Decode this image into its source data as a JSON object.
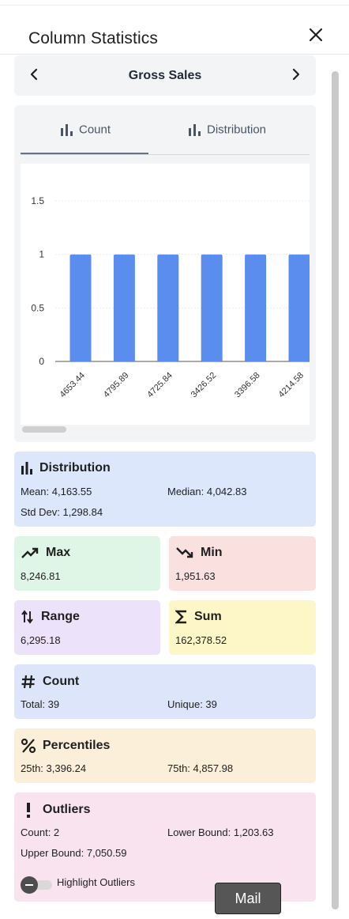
{
  "header": {
    "title": "Column Statistics",
    "close_icon": "close-icon"
  },
  "column_nav": {
    "column_name": "Gross Sales",
    "prev_icon": "chevron-left-icon",
    "next_icon": "chevron-right-icon"
  },
  "tabs": [
    {
      "label": "Count",
      "icon": "bar-chart-icon",
      "active": true
    },
    {
      "label": "Distribution",
      "icon": "bar-chart-icon",
      "active": false
    }
  ],
  "chart_data": {
    "type": "bar",
    "categories": [
      "4653.44",
      "4795.89",
      "4725.84",
      "3426.52",
      "3396.58",
      "4214.58"
    ],
    "values": [
      1,
      1,
      1,
      1,
      1,
      1
    ],
    "ylim": [
      0,
      1.7
    ],
    "yticks": [
      0,
      0.5,
      1,
      1.5
    ],
    "ytick_labels": [
      "0",
      "0.5",
      "1",
      "1.5"
    ],
    "bar_color": "#5b8def",
    "grid": true,
    "title": "",
    "xlabel": "",
    "ylabel": ""
  },
  "stats": {
    "distribution": {
      "title": "Distribution",
      "mean": "Mean: 4,163.55",
      "median": "Median: 4,042.83",
      "std_dev": "Std Dev: 1,298.84",
      "color": "#dce7fb"
    },
    "max": {
      "title": "Max",
      "value": "8,246.81",
      "color": "#dff6e6"
    },
    "min": {
      "title": "Min",
      "value": "1,951.63",
      "color": "#fbe0e0"
    },
    "range": {
      "title": "Range",
      "value": "6,295.18",
      "color": "#ece3fb"
    },
    "sum": {
      "title": "Sum",
      "value": "162,378.52",
      "color": "#fdf6c7"
    },
    "count": {
      "title": "Count",
      "total": "Total: 39",
      "unique": "Unique: 39",
      "color": "#dde5fa"
    },
    "percentiles": {
      "title": "Percentiles",
      "p25": "25th: 3,396.24",
      "p75": "75th: 4,857.98",
      "color": "#fcefd9"
    },
    "outliers": {
      "title": "Outliers",
      "count": "Count: 2",
      "lower_bound": "Lower Bound: 1,203.63",
      "upper_bound": "Upper Bound: 7,050.59",
      "highlight_label": "Highlight Outliers",
      "highlight_on": false,
      "color": "#f9e3ef"
    }
  },
  "footer": {
    "mail_button": "Mail"
  }
}
